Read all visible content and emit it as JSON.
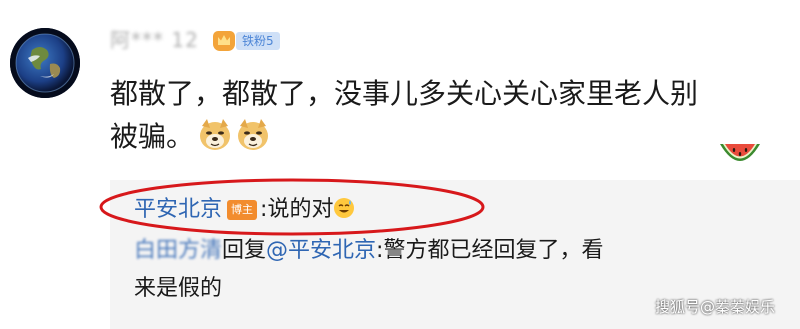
{
  "comment": {
    "username": "阿*** 12",
    "fans_badge": "铁粉5",
    "text_line1": "都散了，都散了，没事儿多关心关心家里老人别",
    "text_line2": "被骗。",
    "emoji": "doge-icon"
  },
  "replies": [
    {
      "author": "平安北京",
      "badge": "博主",
      "separator": ":",
      "text": "说的对",
      "emoji": "sweat-smile-icon",
      "highlighted": true
    },
    {
      "author": "白田方清",
      "action": "回复",
      "mention": "@平安北京",
      "separator": ":",
      "text_line1": "警方都已经回复了，看",
      "text_line2": "来是假的"
    }
  ],
  "watermark": "搜狐号@蓁蓁娱乐",
  "colors": {
    "link": "#2f66b3",
    "highlight_circle": "#d7181b",
    "blogger_badge": "#f28c2e",
    "fans_badge_bg": "#cfe0f7"
  }
}
